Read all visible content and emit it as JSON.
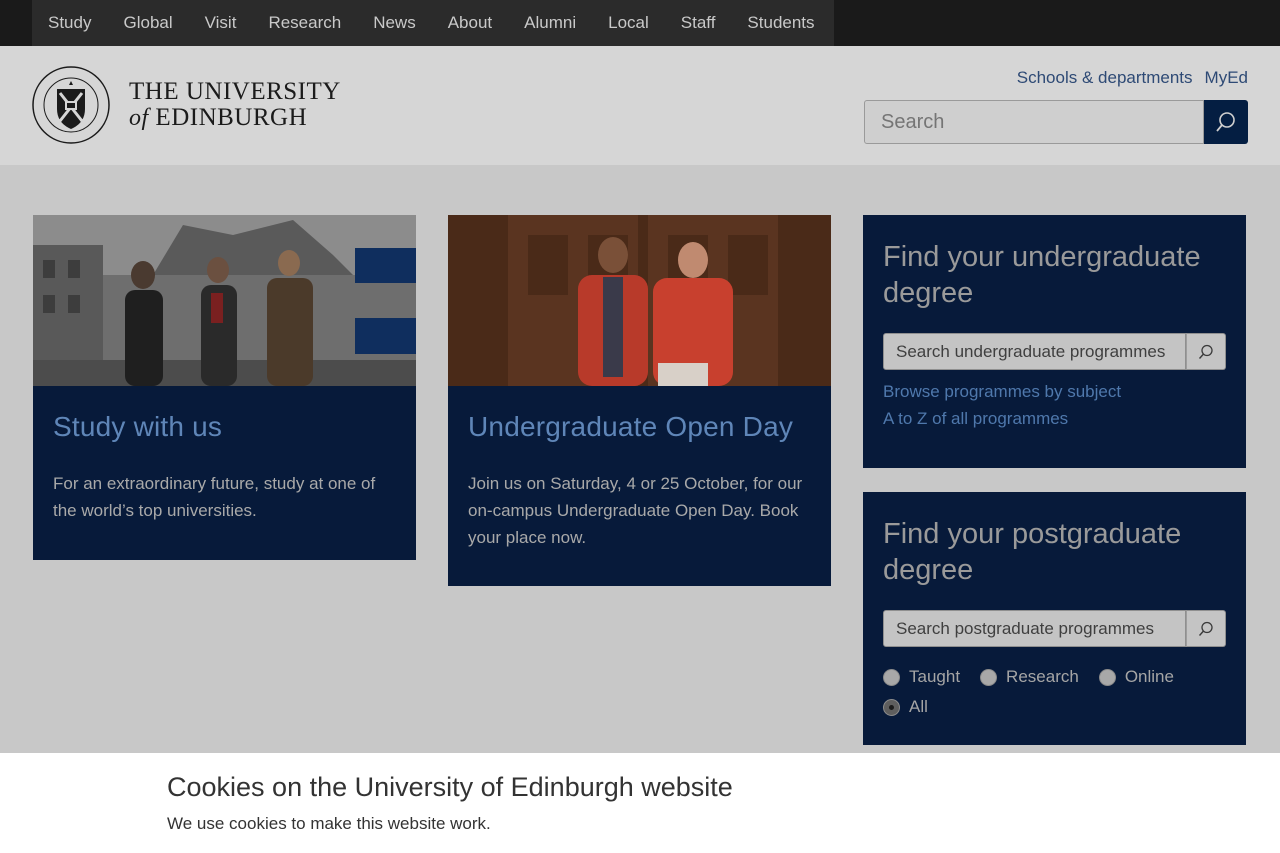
{
  "top_nav": [
    "Study",
    "Global",
    "Visit",
    "Research",
    "News",
    "About",
    "Alumni",
    "Local",
    "Staff",
    "Students"
  ],
  "logo": {
    "line1": "THE UNIVERSITY",
    "of": "of",
    "line2": "EDINBURGH"
  },
  "util_links": {
    "schools": "Schools & departments",
    "myed": "MyEd"
  },
  "search": {
    "placeholder": "Search"
  },
  "cards": [
    {
      "title": "Study with us",
      "text": "For an extraordinary future, study at one of the world’s top universities."
    },
    {
      "title": "Undergraduate Open Day",
      "text": "Join us on Saturday, 4 or 25 October, for our on-campus Undergraduate Open Day. Book your place now."
    }
  ],
  "undergrad": {
    "title": "Find your undergraduate degree",
    "placeholder": "Search undergraduate programmes",
    "link1": "Browse programmes by subject",
    "link2": "A to Z of all programmes"
  },
  "postgrad": {
    "title": "Find your postgraduate degree",
    "placeholder": "Search postgraduate programmes",
    "options": [
      "Taught",
      "Research",
      "Online",
      "All"
    ],
    "selected": "All"
  },
  "cookie": {
    "title": "Cookies on the University of Edinburgh website",
    "text": "We use cookies to make this website work."
  },
  "colors": {
    "navy": "#041e42",
    "link": "#2e4a75"
  }
}
